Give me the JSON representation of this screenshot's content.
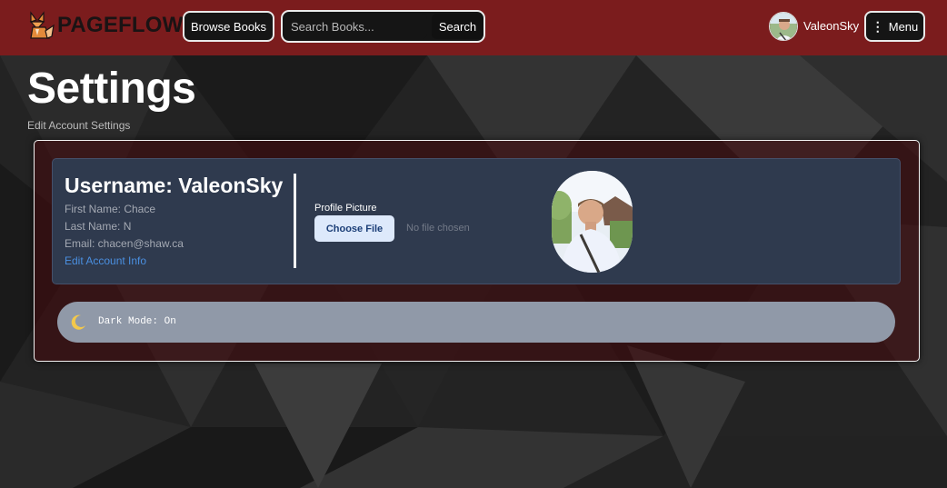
{
  "navbar": {
    "brand": "PAGEFLOW",
    "browse_label": "Browse Books",
    "search_placeholder": "Search Books...",
    "search_label": "Search",
    "username": "ValeonSky",
    "menu_label": "Menu",
    "menu_icon": "vertical-dots"
  },
  "header": {
    "title": "Settings",
    "subtitle": "Edit Account Settings"
  },
  "account": {
    "username_line": "Username: ValeonSky",
    "first_name_line": "First Name: Chace",
    "last_name_line": "Last Name: N",
    "email_line": "Email: chacen@shaw.ca",
    "edit_link": "Edit Account Info"
  },
  "profile_picture": {
    "label": "Profile Picture",
    "choose_label": "Choose File",
    "status": "No file chosen"
  },
  "dark_mode": {
    "label": "Dark Mode: On",
    "icon": "moon-icon"
  },
  "colors": {
    "navbar": "#7b1c1d",
    "card": "#2f3a4e",
    "toggle_bar": "#9099a8",
    "link": "#4a8fe0"
  }
}
